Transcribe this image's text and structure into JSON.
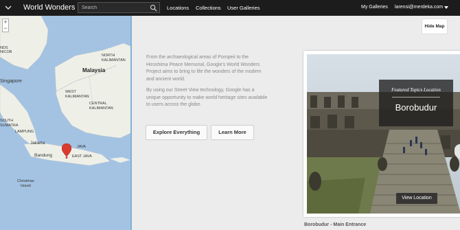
{
  "topbar": {
    "menu_icon": "chevron-down-icon",
    "brand": "World Wonders",
    "search_placeholder": "Search",
    "search_icon": "search-icon",
    "nav": [
      "Locations",
      "Collections",
      "User Galleries"
    ],
    "my_galleries": "My Galleries",
    "user_email": "larensi@merdeka.com"
  },
  "map": {
    "zoom_in": "+",
    "zoom_out": "−",
    "marker_icon": "map-pin-icon",
    "labels": {
      "malaysia": "Malaysia",
      "singapore": "Singapore",
      "kalimantan": "KALIMANTAN",
      "north": "NORTH",
      "west_kalimantan": "WEST\nKALIMANTAN",
      "central_kalimantan": "CENTRAL\nKALIMANTAN",
      "south_sumatra": "SOUTH\nSUMATRA",
      "lampung": "LAMPUNG",
      "jakarta": "Jakarta",
      "bandung": "Bandung",
      "java": "JAVA",
      "east_java": "EAST JAVA",
      "christmas_island": "Christmas\nIsland",
      "nicob": "NICOB",
      "nds": "NDS"
    }
  },
  "intro": {
    "para1": "From the archaeological areas of Pompeii to the Hiroshima Peace Memorial, Google's World Wonders Project aims to bring to life the wonders of the modern and ancient world.",
    "para2": "By using our Street View technology, Google has a unique opportunity to make world heritage sites available to users across the globe."
  },
  "buttons": {
    "explore": "Explore Everything",
    "learn_more": "Learn More",
    "hide_map": "Hide Map"
  },
  "featured": {
    "kicker": "Featured Topics Location",
    "title": "Borobudur",
    "view_location": "View Location",
    "caption": "Borobudur - Main Entrance"
  }
}
